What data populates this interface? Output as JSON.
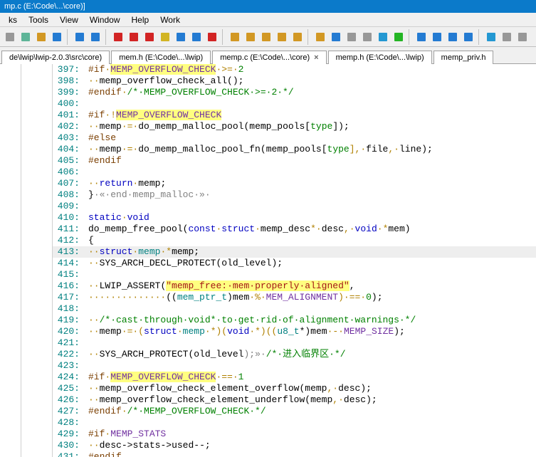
{
  "titlebar": "mp.c (E:\\Code\\...\\core)]",
  "menu": [
    "ks",
    "Tools",
    "View",
    "Window",
    "Help",
    "Work"
  ],
  "tabs": [
    {
      "label": "de\\lwip\\lwip-2.0.3\\src\\core)",
      "close": false
    },
    {
      "label": "mem.h  (E:\\Code\\...\\lwip)",
      "close": false
    },
    {
      "label": "memp.c  (E:\\Code\\...\\core)",
      "close": true,
      "active": true
    },
    {
      "label": "memp.h  (E:\\Code\\...\\lwip)",
      "close": false
    },
    {
      "label": "memp_priv.h",
      "close": false
    }
  ],
  "toolbar_icons": [
    "new",
    "copy",
    "paste",
    "align-left",
    "sep",
    "undo",
    "redo",
    "sep",
    "doc-red",
    "arrow-up",
    "arrow-down",
    "doc-yellow",
    "nav",
    "x-y",
    "brace",
    "sep",
    "left-end",
    "left",
    "right",
    "right-end",
    "star",
    "sep",
    "find",
    "replace",
    "book",
    "book2",
    "sync",
    "lightning",
    "sep",
    "grid1",
    "grid2",
    "grid3",
    "grid4",
    "sep",
    "info",
    "ruler",
    "pin"
  ],
  "code_lines": [
    {
      "n": 397,
      "tokens": [
        {
          "t": "#if",
          "c": "kw-preproc"
        },
        {
          "t": "·",
          "c": "dot"
        },
        {
          "t": "MEMP_OVERFLOW_CHECK",
          "c": "hl-yellow purple"
        },
        {
          "t": "·>=·",
          "c": "dot"
        },
        {
          "t": "2",
          "c": "kw-green"
        }
      ]
    },
    {
      "n": 398,
      "tokens": [
        {
          "t": "··",
          "c": "dot"
        },
        {
          "t": "memp_overflow_check_all",
          "c": "punct"
        },
        {
          "t": "();",
          "c": "punct"
        }
      ]
    },
    {
      "n": 399,
      "tokens": [
        {
          "t": "#endif",
          "c": "kw-preproc"
        },
        {
          "t": "·",
          "c": "dot"
        },
        {
          "t": "/*·MEMP_OVERFLOW_CHECK·>=·2·*/",
          "c": "kw-green"
        }
      ]
    },
    {
      "n": 400,
      "tokens": []
    },
    {
      "n": 401,
      "tokens": [
        {
          "t": "#if",
          "c": "kw-preproc"
        },
        {
          "t": "·!",
          "c": "dot"
        },
        {
          "t": "MEMP_OVERFLOW_CHECK",
          "c": "hl-yellow purple"
        }
      ]
    },
    {
      "n": 402,
      "tokens": [
        {
          "t": "··",
          "c": "dot"
        },
        {
          "t": "memp",
          "c": "punct"
        },
        {
          "t": "·=·",
          "c": "dot"
        },
        {
          "t": "do_memp_malloc_pool",
          "c": "punct"
        },
        {
          "t": "(",
          "c": "punct"
        },
        {
          "t": "memp_pools",
          "c": "punct"
        },
        {
          "t": "[",
          "c": "punct"
        },
        {
          "t": "type",
          "c": "kw-green"
        },
        {
          "t": "]);",
          "c": "punct"
        }
      ]
    },
    {
      "n": 403,
      "tokens": [
        {
          "t": "#else",
          "c": "kw-preproc"
        }
      ]
    },
    {
      "n": 404,
      "tokens": [
        {
          "t": "··",
          "c": "dot"
        },
        {
          "t": "memp",
          "c": "punct"
        },
        {
          "t": "·=·",
          "c": "dot"
        },
        {
          "t": "do_memp_malloc_pool_fn",
          "c": "punct"
        },
        {
          "t": "(",
          "c": "punct"
        },
        {
          "t": "memp_pools",
          "c": "punct"
        },
        {
          "t": "[",
          "c": "punct"
        },
        {
          "t": "type",
          "c": "kw-green"
        },
        {
          "t": "],·",
          "c": "dot"
        },
        {
          "t": "file",
          "c": "punct"
        },
        {
          "t": ",·",
          "c": "dot"
        },
        {
          "t": "line",
          "c": "punct"
        },
        {
          "t": ");",
          "c": "punct"
        }
      ]
    },
    {
      "n": 405,
      "tokens": [
        {
          "t": "#endif",
          "c": "kw-preproc"
        }
      ]
    },
    {
      "n": 406,
      "tokens": []
    },
    {
      "n": 407,
      "tokens": [
        {
          "t": "··",
          "c": "dot"
        },
        {
          "t": "return",
          "c": "kw-blue"
        },
        {
          "t": "·",
          "c": "dot"
        },
        {
          "t": "memp",
          "c": "punct"
        },
        {
          "t": ";",
          "c": "punct"
        }
      ]
    },
    {
      "n": 408,
      "tokens": [
        {
          "t": "}",
          "c": "punct"
        },
        {
          "t": "·«·end·memp_malloc·»·",
          "c": "gray"
        }
      ]
    },
    {
      "n": 409,
      "tokens": []
    },
    {
      "n": 410,
      "tokens": [
        {
          "t": "static",
          "c": "kw-blue"
        },
        {
          "t": "·",
          "c": "dot"
        },
        {
          "t": "void",
          "c": "kw-blue"
        }
      ]
    },
    {
      "n": 411,
      "tokens": [
        {
          "t": "do_memp_free_pool",
          "c": "punct"
        },
        {
          "t": "(",
          "c": "punct"
        },
        {
          "t": "const",
          "c": "kw-blue"
        },
        {
          "t": "·",
          "c": "dot"
        },
        {
          "t": "struct",
          "c": "kw-blue"
        },
        {
          "t": "·",
          "c": "dot"
        },
        {
          "t": "memp_desc",
          "c": "punct"
        },
        {
          "t": "*·",
          "c": "dot"
        },
        {
          "t": "desc",
          "c": "punct"
        },
        {
          "t": ",·",
          "c": "dot"
        },
        {
          "t": "void",
          "c": "kw-blue"
        },
        {
          "t": "·*",
          "c": "dot"
        },
        {
          "t": "mem",
          "c": "punct"
        },
        {
          "t": ")",
          "c": "punct"
        }
      ]
    },
    {
      "n": 412,
      "tokens": [
        {
          "t": "{",
          "c": "punct"
        }
      ]
    },
    {
      "n": 413,
      "current": true,
      "tokens": [
        {
          "t": "··",
          "c": "dot"
        },
        {
          "t": "struct",
          "c": "kw-blue"
        },
        {
          "t": "·",
          "c": "dot"
        },
        {
          "t": "memp",
          "c": "teal"
        },
        {
          "t": "·*",
          "c": "dot"
        },
        {
          "t": "memp",
          "c": "punct"
        },
        {
          "t": ";",
          "c": "punct"
        }
      ]
    },
    {
      "n": 414,
      "tokens": [
        {
          "t": "··",
          "c": "dot"
        },
        {
          "t": "SYS_ARCH_DECL_PROTECT",
          "c": "punct"
        },
        {
          "t": "(",
          "c": "punct"
        },
        {
          "t": "old_level",
          "c": "punct"
        },
        {
          "t": ");",
          "c": "punct"
        }
      ]
    },
    {
      "n": 415,
      "tokens": []
    },
    {
      "n": 416,
      "tokens": [
        {
          "t": "··",
          "c": "dot"
        },
        {
          "t": "LWIP_ASSERT",
          "c": "punct"
        },
        {
          "t": "(",
          "c": "punct"
        },
        {
          "t": "\"memp_free:·mem·properly·aligned\"",
          "c": "hl-yellow str"
        },
        {
          "t": ",",
          "c": "punct"
        }
      ]
    },
    {
      "n": 417,
      "tokens": [
        {
          "t": "··············",
          "c": "dot"
        },
        {
          "t": "((",
          "c": "punct"
        },
        {
          "t": "mem_ptr_t",
          "c": "teal"
        },
        {
          "t": ")",
          "c": "punct"
        },
        {
          "t": "mem",
          "c": "punct"
        },
        {
          "t": "·%·",
          "c": "dot"
        },
        {
          "t": "MEM_ALIGNMENT",
          "c": "purple"
        },
        {
          "t": ")·==·",
          "c": "dot"
        },
        {
          "t": "0",
          "c": "kw-green"
        },
        {
          "t": ");",
          "c": "punct"
        }
      ]
    },
    {
      "n": 418,
      "tokens": []
    },
    {
      "n": 419,
      "tokens": [
        {
          "t": "··",
          "c": "dot"
        },
        {
          "t": "/*·cast·through·void*·to·get·rid·of·alignment·warnings·*/",
          "c": "kw-green"
        }
      ]
    },
    {
      "n": 420,
      "tokens": [
        {
          "t": "··",
          "c": "dot"
        },
        {
          "t": "memp",
          "c": "punct"
        },
        {
          "t": "·=·(",
          "c": "dot"
        },
        {
          "t": "struct",
          "c": "kw-blue"
        },
        {
          "t": "·",
          "c": "dot"
        },
        {
          "t": "memp",
          "c": "teal"
        },
        {
          "t": "·*)(",
          "c": "dot"
        },
        {
          "t": "void",
          "c": "kw-blue"
        },
        {
          "t": "·*)((",
          "c": "dot"
        },
        {
          "t": "u8_t",
          "c": "teal"
        },
        {
          "t": "*)",
          "c": "punct"
        },
        {
          "t": "mem",
          "c": "punct"
        },
        {
          "t": "·-·",
          "c": "dot"
        },
        {
          "t": "MEMP_SIZE",
          "c": "purple"
        },
        {
          "t": ");",
          "c": "punct"
        }
      ]
    },
    {
      "n": 421,
      "tokens": []
    },
    {
      "n": 422,
      "tokens": [
        {
          "t": "··",
          "c": "dot"
        },
        {
          "t": "SYS_ARCH_PROTECT",
          "c": "punct"
        },
        {
          "t": "(",
          "c": "punct"
        },
        {
          "t": "old_level",
          "c": "punct"
        },
        {
          "t": ");»·",
          "c": "gray"
        },
        {
          "t": "/*·进入临界区·*/",
          "c": "kw-green"
        }
      ]
    },
    {
      "n": 423,
      "tokens": []
    },
    {
      "n": 424,
      "tokens": [
        {
          "t": "#if",
          "c": "kw-preproc"
        },
        {
          "t": "·",
          "c": "dot"
        },
        {
          "t": "MEMP_OVERFLOW_CHECK",
          "c": "hl-yellow purple"
        },
        {
          "t": "·==·",
          "c": "dot"
        },
        {
          "t": "1",
          "c": "kw-green"
        }
      ]
    },
    {
      "n": 425,
      "tokens": [
        {
          "t": "··",
          "c": "dot"
        },
        {
          "t": "memp_overflow_check_element_overflow",
          "c": "punct"
        },
        {
          "t": "(",
          "c": "punct"
        },
        {
          "t": "memp",
          "c": "punct"
        },
        {
          "t": ",·",
          "c": "dot"
        },
        {
          "t": "desc",
          "c": "punct"
        },
        {
          "t": ");",
          "c": "punct"
        }
      ]
    },
    {
      "n": 426,
      "tokens": [
        {
          "t": "··",
          "c": "dot"
        },
        {
          "t": "memp_overflow_check_element_underflow",
          "c": "punct"
        },
        {
          "t": "(",
          "c": "punct"
        },
        {
          "t": "memp",
          "c": "punct"
        },
        {
          "t": ",·",
          "c": "dot"
        },
        {
          "t": "desc",
          "c": "punct"
        },
        {
          "t": ");",
          "c": "punct"
        }
      ]
    },
    {
      "n": 427,
      "tokens": [
        {
          "t": "#endif",
          "c": "kw-preproc"
        },
        {
          "t": "·",
          "c": "dot"
        },
        {
          "t": "/*·MEMP_OVERFLOW_CHECK·*/",
          "c": "kw-green"
        }
      ]
    },
    {
      "n": 428,
      "tokens": []
    },
    {
      "n": 429,
      "tokens": [
        {
          "t": "#if",
          "c": "kw-preproc"
        },
        {
          "t": "·",
          "c": "dot"
        },
        {
          "t": "MEMP_STATS",
          "c": "purple"
        }
      ]
    },
    {
      "n": 430,
      "tokens": [
        {
          "t": "··",
          "c": "dot"
        },
        {
          "t": "desc",
          "c": "punct"
        },
        {
          "t": "->",
          "c": "punct"
        },
        {
          "t": "stats",
          "c": "punct"
        },
        {
          "t": "->",
          "c": "punct"
        },
        {
          "t": "used",
          "c": "punct"
        },
        {
          "t": "--;",
          "c": "punct"
        }
      ]
    },
    {
      "n": 431,
      "tokens": [
        {
          "t": "#endif",
          "c": "kw-preproc"
        }
      ]
    }
  ]
}
